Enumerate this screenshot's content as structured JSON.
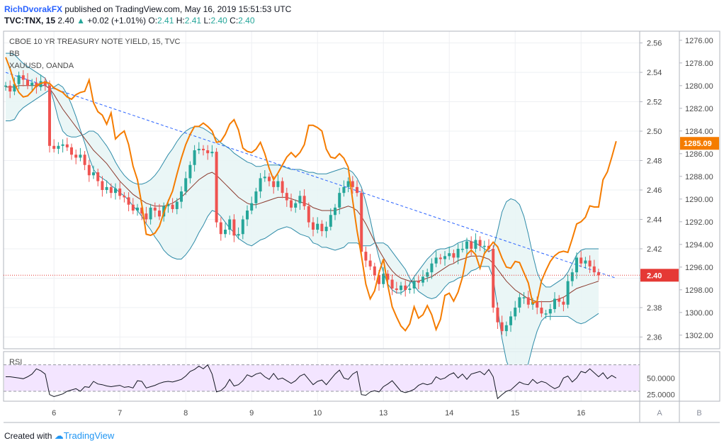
{
  "header": {
    "author": "RichDvorakFX",
    "published_text": "published on TradingView.com, May 16, 2019 15:51:53 UTC",
    "symbol": "TVC:TNX, 15",
    "last_price": "2.40",
    "change_arrow": "▲",
    "change": "+0.02 (+1.01%)",
    "o_label": "O:",
    "o_value": "2.41",
    "h_label": "H:",
    "h_value": "2.41",
    "l_label": "L:",
    "l_value": "2.40",
    "c_label": "C:",
    "c_value": "2.40"
  },
  "legend": {
    "main": "CBOE 10 YR TREASURY NOTE YIELD, 15, TVC",
    "bb": "BB",
    "overlay": "XAUUSD, OANDA"
  },
  "rsi": {
    "label": "RSI",
    "ticks": [
      "50.0000",
      "25.0000"
    ]
  },
  "tabs": [
    "A",
    "B"
  ],
  "footer": {
    "created_with": "Created with",
    "brand": "TradingView"
  },
  "colors": {
    "up": "#26a69a",
    "down": "#ef5350",
    "gold": "#f57c00",
    "bb": "#2e8ba8",
    "trend": "#2962ff",
    "price_line": "#e53935",
    "rsi_fill": "#f3e5ff"
  },
  "chart_data": {
    "type": "line",
    "x_labels": [
      "6",
      "7",
      "8",
      "9",
      "10",
      "13",
      "14",
      "15",
      "16"
    ],
    "left_axis": {
      "ticks": [
        "2.56",
        "2.54",
        "2.52",
        "2.50",
        "2.48",
        "2.46",
        "2.44",
        "2.42",
        "2.40",
        "2.38",
        "2.36"
      ],
      "range": [
        2.352,
        2.568
      ]
    },
    "right_axis": {
      "ticks": [
        "1276.00",
        "1278.00",
        "1280.00",
        "1282.00",
        "1284.00",
        "1286.00",
        "1288.00",
        "1290.00",
        "1292.00",
        "1294.00",
        "1296.00",
        "1298.00",
        "1300.00",
        "1302.00"
      ],
      "range": [
        1275.2,
        1303.2
      ],
      "inverted": true
    },
    "current_price_label": "2.40",
    "current_gold_label": "1285.09",
    "series": [
      {
        "name": "CBOE 10 YR TREASURY NOTE YIELD",
        "close": [
          2.531,
          2.527,
          2.532,
          2.538,
          2.535,
          2.531,
          2.533,
          2.53,
          2.534,
          2.531,
          2.49,
          2.488,
          2.49,
          2.491,
          2.489,
          2.484,
          2.482,
          2.484,
          2.477,
          2.47,
          2.472,
          2.466,
          2.46,
          2.462,
          2.458,
          2.461,
          2.456,
          2.455,
          2.45,
          2.446,
          2.448,
          2.444,
          2.44,
          2.448,
          2.446,
          2.442,
          2.449,
          2.45,
          2.447,
          2.452,
          2.459,
          2.468,
          2.477,
          2.487,
          2.488,
          2.487,
          2.485,
          2.486,
          2.438,
          2.43,
          2.433,
          2.44,
          2.429,
          2.43,
          2.44,
          2.446,
          2.451,
          2.459,
          2.468,
          2.469,
          2.466,
          2.462,
          2.466,
          2.458,
          2.453,
          2.448,
          2.451,
          2.456,
          2.449,
          2.438,
          2.433,
          2.437,
          2.432,
          2.435,
          2.443,
          2.448,
          2.458,
          2.462,
          2.466,
          2.462,
          2.458,
          2.418,
          2.412,
          2.408,
          2.402,
          2.396,
          2.403,
          2.399,
          2.393,
          2.392,
          2.395,
          2.392,
          2.393,
          2.398,
          2.397,
          2.401,
          2.404,
          2.41,
          2.414,
          2.413,
          2.415,
          2.417,
          2.414,
          2.42,
          2.42,
          2.425,
          2.42,
          2.426,
          2.422,
          2.422,
          2.42,
          2.38,
          2.37,
          2.364,
          2.368,
          2.374,
          2.38,
          2.387,
          2.387,
          2.382,
          2.384,
          2.38,
          2.376,
          2.376,
          2.379,
          2.386,
          2.384,
          2.382,
          2.398,
          2.404,
          2.414,
          2.41,
          2.412,
          2.408,
          2.404,
          2.402
        ],
        "bb_upper": [
          2.553,
          2.553,
          2.552,
          2.549,
          2.546,
          2.544,
          2.542,
          2.54,
          2.538,
          2.536,
          2.53,
          2.52,
          2.508,
          2.5,
          2.497,
          2.496,
          2.496,
          2.497,
          2.498,
          2.5,
          2.5,
          2.498,
          2.494,
          2.49,
          2.485,
          2.479,
          2.474,
          2.47,
          2.467,
          2.465,
          2.464,
          2.464,
          2.465,
          2.467,
          2.47,
          2.474,
          2.479,
          2.484,
          2.488,
          2.493,
          2.497,
          2.5,
          2.502,
          2.503,
          2.503,
          2.502,
          2.5,
          2.498,
          2.495,
          2.492,
          2.49,
          2.488,
          2.485,
          2.483,
          2.481,
          2.479,
          2.478,
          2.476,
          2.476,
          2.477,
          2.477,
          2.477,
          2.477,
          2.476,
          2.475,
          2.474,
          2.474,
          2.474,
          2.473,
          2.472,
          2.472,
          2.471,
          2.471,
          2.471,
          2.472,
          2.473,
          2.474,
          2.475,
          2.474,
          2.472,
          2.468,
          2.462,
          2.452,
          2.44,
          2.426,
          2.414,
          2.404,
          2.396,
          2.392,
          2.39,
          2.39,
          2.392,
          2.396,
          2.401,
          2.405,
          2.409,
          2.413,
          2.416,
          2.419,
          2.42,
          2.42,
          2.421,
          2.422,
          2.424,
          2.425,
          2.426,
          2.425,
          2.424,
          2.422,
          2.42,
          2.418,
          2.42,
          2.432,
          2.445,
          2.452,
          2.454,
          2.453,
          2.45,
          2.442,
          2.43,
          2.416,
          2.404,
          2.397,
          2.394,
          2.394,
          2.396,
          2.398,
          2.4,
          2.404,
          2.41,
          2.416,
          2.419,
          2.42,
          2.42,
          2.42,
          2.42
        ],
        "bb_basis": [
          2.53,
          2.53,
          2.53,
          2.531,
          2.531,
          2.531,
          2.531,
          2.531,
          2.531,
          2.531,
          2.529,
          2.525,
          2.52,
          2.515,
          2.511,
          2.507,
          2.503,
          2.499,
          2.495,
          2.491,
          2.487,
          2.484,
          2.481,
          2.478,
          2.474,
          2.47,
          2.466,
          2.463,
          2.46,
          2.457,
          2.455,
          2.453,
          2.451,
          2.45,
          2.449,
          2.449,
          2.449,
          2.45,
          2.451,
          2.453,
          2.455,
          2.458,
          2.461,
          2.464,
          2.467,
          2.469,
          2.471,
          2.472,
          2.47,
          2.467,
          2.464,
          2.461,
          2.458,
          2.455,
          2.453,
          2.451,
          2.45,
          2.45,
          2.451,
          2.452,
          2.453,
          2.454,
          2.455,
          2.455,
          2.455,
          2.454,
          2.453,
          2.452,
          2.451,
          2.45,
          2.448,
          2.447,
          2.446,
          2.446,
          2.446,
          2.446,
          2.447,
          2.448,
          2.449,
          2.448,
          2.446,
          2.442,
          2.437,
          2.431,
          2.425,
          2.419,
          2.414,
          2.409,
          2.405,
          2.402,
          2.4,
          2.399,
          2.398,
          2.398,
          2.398,
          2.399,
          2.4,
          2.401,
          2.403,
          2.405,
          2.407,
          2.409,
          2.41,
          2.412,
          2.413,
          2.414,
          2.415,
          2.415,
          2.415,
          2.414,
          2.413,
          2.41,
          2.406,
          2.402,
          2.398,
          2.395,
          2.392,
          2.39,
          2.388,
          2.386,
          2.385,
          2.384,
          2.384,
          2.384,
          2.384,
          2.385,
          2.386,
          2.387,
          2.389,
          2.391,
          2.393,
          2.394,
          2.395,
          2.396,
          2.397,
          2.398
        ],
        "bb_lower": [
          2.507,
          2.507,
          2.508,
          2.513,
          2.516,
          2.518,
          2.52,
          2.522,
          2.524,
          2.526,
          2.528,
          2.53,
          2.532,
          2.53,
          2.525,
          2.518,
          2.51,
          2.501,
          2.492,
          2.482,
          2.474,
          2.47,
          2.468,
          2.466,
          2.463,
          2.461,
          2.458,
          2.456,
          2.453,
          2.449,
          2.446,
          2.442,
          2.437,
          2.433,
          2.428,
          2.424,
          2.419,
          2.416,
          2.414,
          2.413,
          2.413,
          2.416,
          2.42,
          2.425,
          2.431,
          2.436,
          2.442,
          2.446,
          2.445,
          2.442,
          2.438,
          2.434,
          2.431,
          2.427,
          2.425,
          2.423,
          2.422,
          2.424,
          2.426,
          2.427,
          2.429,
          2.431,
          2.433,
          2.434,
          2.435,
          2.434,
          2.432,
          2.43,
          2.429,
          2.428,
          2.424,
          2.423,
          2.421,
          2.421,
          2.42,
          2.419,
          2.42,
          2.421,
          2.424,
          2.424,
          2.424,
          2.422,
          2.422,
          2.422,
          2.424,
          2.424,
          2.424,
          2.422,
          2.418,
          2.414,
          2.41,
          2.406,
          2.4,
          2.395,
          2.391,
          2.389,
          2.387,
          2.386,
          2.387,
          2.39,
          2.394,
          2.397,
          2.398,
          2.4,
          2.401,
          2.402,
          2.405,
          2.406,
          2.408,
          2.408,
          2.408,
          2.4,
          2.38,
          2.359,
          2.344,
          2.336,
          2.331,
          2.33,
          2.334,
          2.342,
          2.354,
          2.364,
          2.371,
          2.374,
          2.374,
          2.374,
          2.374,
          2.374,
          2.374,
          2.372,
          2.37,
          2.369,
          2.37,
          2.372,
          2.374,
          2.376
        ],
        "trendline": [
          [
            0,
            2.54
          ],
          [
            139,
            2.4
          ]
        ]
      },
      {
        "name": "XAUUSD, OANDA",
        "close": [
          1277.5,
          1278.5,
          1279.8,
          1280.6,
          1281.0,
          1280.9,
          1280.5,
          1280.0,
          1279.8,
          1279.7,
          1279.8,
          1280.2,
          1280.4,
          1280.6,
          1281.0,
          1281.2,
          1280.8,
          1280.6,
          1280.5,
          1279.5,
          1281.5,
          1282.3,
          1282.6,
          1283.4,
          1282.4,
          1284.7,
          1284.3,
          1284.0,
          1285.2,
          1287.1,
          1288.3,
          1290.5,
          1293.1,
          1293.2,
          1293.0,
          1292.4,
          1291.2,
          1290.2,
          1289.3,
          1287.8,
          1286.4,
          1285.2,
          1284.3,
          1283.6,
          1283.6,
          1283.3,
          1283.6,
          1284.0,
          1285.0,
          1284.9,
          1284.3,
          1283.4,
          1283.0,
          1283.9,
          1285.5,
          1285.8,
          1285.9,
          1285.6,
          1285.0,
          1286.0,
          1287.3,
          1288.3,
          1287.7,
          1287.0,
          1286.3,
          1285.9,
          1286.3,
          1285.9,
          1285.2,
          1283.5,
          1283.5,
          1283.7,
          1284.0,
          1285.6,
          1286.3,
          1286.4,
          1286.0,
          1286.4,
          1287.2,
          1290.1,
          1292.8,
          1295.0,
          1297.5,
          1298.8,
          1298.1,
          1296.5,
          1295.3,
          1297.6,
          1299.5,
          1300.4,
          1301.2,
          1301.6,
          1301.0,
          1299.5,
          1300.5,
          1300.2,
          1299.4,
          1300.2,
          1301.5,
          1300.6,
          1298.5,
          1298.3,
          1299.0,
          1298.2,
          1296.9,
          1294.9,
          1294.5,
          1294.9,
          1296.1,
          1294.8,
          1294.3,
          1293.8,
          1294.2,
          1295.2,
          1296.0,
          1296.1,
          1295.5,
          1295.6,
          1296.5,
          1297.4,
          1299.2,
          1299.0,
          1297.2,
          1296.3,
          1295.5,
          1295.0,
          1294.7,
          1294.6,
          1294.7,
          1293.5,
          1292.2,
          1292.0,
          1291.6,
          1290.6,
          1290.7,
          1290.7,
          1288.3,
          1287.6,
          1286.3,
          1284.9
        ]
      }
    ],
    "rsi_series": [
      52,
      52,
      51,
      50,
      49,
      52,
      56,
      64,
      61,
      56,
      25,
      22,
      24,
      26,
      30,
      32,
      34,
      30,
      37,
      36,
      45,
      41,
      40,
      38,
      37,
      38,
      39,
      36,
      37,
      35,
      46,
      45,
      35,
      37,
      39,
      42,
      44,
      45,
      44,
      46,
      48,
      53,
      60,
      63,
      68,
      64,
      70,
      56,
      29,
      31,
      37,
      48,
      38,
      40,
      46,
      55,
      52,
      56,
      58,
      52,
      48,
      57,
      48,
      50,
      46,
      42,
      46,
      53,
      56,
      48,
      40,
      45,
      47,
      40,
      48,
      56,
      62,
      50,
      48,
      56,
      60,
      25,
      24,
      29,
      31,
      29,
      37,
      41,
      46,
      38,
      30,
      28,
      30,
      33,
      39,
      42,
      40,
      42,
      52,
      48,
      50,
      55,
      58,
      50,
      56,
      48,
      56,
      58,
      60,
      55,
      63,
      52,
      19,
      25,
      30,
      32,
      38,
      44,
      41,
      40,
      48,
      42,
      45,
      43,
      38,
      34,
      37,
      50,
      53,
      44,
      50,
      60,
      58,
      64,
      58,
      52,
      58,
      49,
      54,
      50
    ],
    "rsi_ticks": [
      50,
      25
    ],
    "rsi_range": [
      15,
      90
    ]
  }
}
